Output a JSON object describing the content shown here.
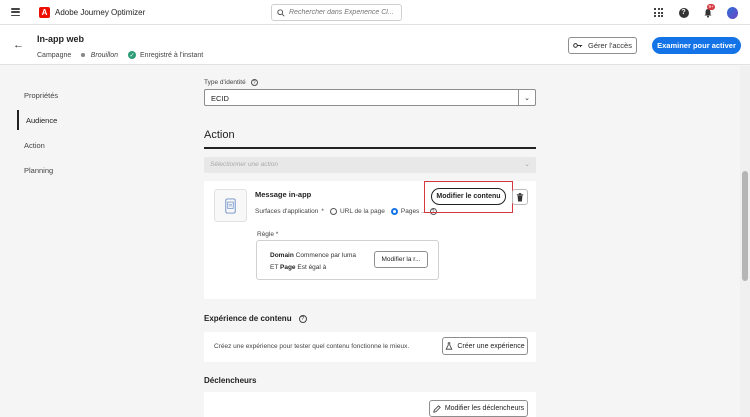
{
  "app": {
    "title": "Adobe Journey Optimizer",
    "logo_letter": "A"
  },
  "search": {
    "placeholder": "Rechercher dans Experience Cl..."
  },
  "topbar": {
    "notification_count": "9+"
  },
  "header": {
    "title": "In-app web",
    "type": "Campagne",
    "status": "Brouillon",
    "saved": "Enregistré à l'instant",
    "manage_access": "Gérer l'accès",
    "review_activate": "Examiner pour activer"
  },
  "nav": {
    "items": [
      {
        "label": "Propriétés"
      },
      {
        "label": "Audience"
      },
      {
        "label": "Action"
      },
      {
        "label": "Planning"
      }
    ],
    "active": "Audience"
  },
  "identity": {
    "label": "Type d'identité",
    "value": "ECID"
  },
  "action": {
    "heading": "Action",
    "select_placeholder": "Sélectionner une action",
    "message_title": "Message in-app",
    "surfaces_label": "Surfaces d'application",
    "surfaces_required": "*",
    "option_url": "URL de la page",
    "option_pages": "Pages ...",
    "modify_content": "Modifier le contenu",
    "rule_label": "Règle *",
    "rule_line1_key": "Domain",
    "rule_line1_rest": "Commence par  luma",
    "rule_line2_key1": "ET",
    "rule_line2_key2": "Page",
    "rule_line2_rest": "Est égal à",
    "modify_rule": "Modifier la r..."
  },
  "experience": {
    "heading": "Expérience de contenu",
    "description": "Créez une expérience pour tester quel contenu fonctionne le mieux.",
    "button": "Créer une expérience"
  },
  "triggers": {
    "heading": "Déclencheurs",
    "button": "Modifier les déclencheurs"
  },
  "colors": {
    "accent": "#1473e6",
    "brand": "#eb1000",
    "highlight": "#d7373f",
    "success": "#2d9d78"
  }
}
